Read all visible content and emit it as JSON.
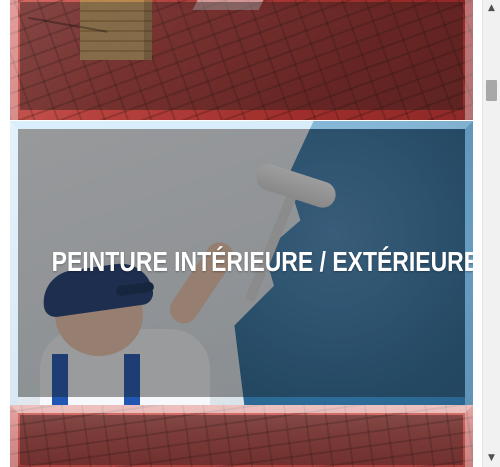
{
  "services": {
    "cards": [
      {
        "title": "",
        "image_icon": "roof-image-icon"
      },
      {
        "title": "PEINTURE INTÉRIEURE / EXTÉRIEURE",
        "image_icon": "painter-image-icon"
      },
      {
        "title": "",
        "image_icon": "roof-image-icon"
      }
    ]
  },
  "scrollbar": {
    "up_icon": "chevron-up-icon",
    "down_icon": "chevron-down-icon",
    "up_glyph": "▲",
    "down_glyph": "▼"
  },
  "colors": {
    "overlay": "#1a1a1a",
    "title_text": "#ffffff",
    "roof_red": "#b7423d",
    "paint_blue": "#2d6b98",
    "scroll_track": "#f1f1f1",
    "scroll_thumb": "#a8a8a8"
  }
}
